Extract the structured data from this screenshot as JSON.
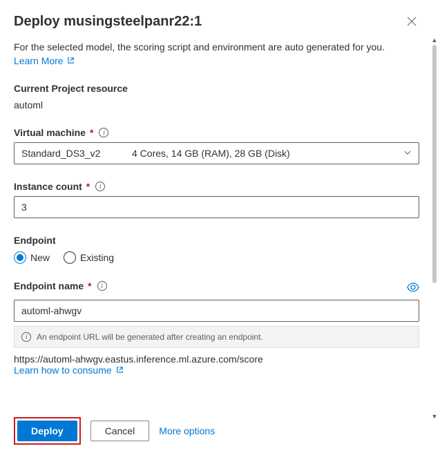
{
  "header": {
    "title": "Deploy musingsteelpanr22:1"
  },
  "subtitle": "For the selected model, the scoring script and environment are auto generated for you.",
  "learn_more": "Learn More",
  "project": {
    "label": "Current Project resource",
    "value": "automl"
  },
  "vm": {
    "label": "Virtual machine",
    "selected": "Standard_DS3_v2",
    "detail": "4 Cores, 14 GB (RAM), 28 GB (Disk)"
  },
  "instance": {
    "label": "Instance count",
    "value": "3"
  },
  "endpoint": {
    "label": "Endpoint",
    "options": {
      "new": "New",
      "existing": "Existing"
    },
    "name_label": "Endpoint name",
    "name_value": "automl-ahwgv",
    "banner": "An endpoint URL will be generated after creating an endpoint.",
    "url": "https://automl-ahwgv.eastus.inference.ml.azure.com/score",
    "consume_link": "Learn how to consume"
  },
  "footer": {
    "deploy": "Deploy",
    "cancel": "Cancel",
    "more": "More options"
  }
}
